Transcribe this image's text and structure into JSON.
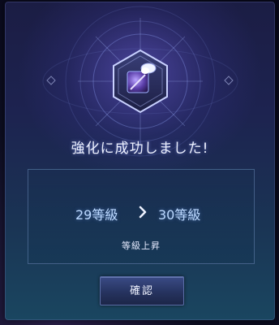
{
  "dialog": {
    "title": "強化に成功しました!",
    "level_from": "29等級",
    "level_to": "30等級",
    "caption": "等級上昇",
    "confirm_label": "確認"
  },
  "icons": {
    "emblem": "enhancement-emblem-icon",
    "arrow": "chevron-right-icon"
  },
  "colors": {
    "panel_border": "#7896c8",
    "button_bg": "#2c3a6c",
    "title_text": "#eef2ff",
    "level_text": "#bcd9ff"
  }
}
